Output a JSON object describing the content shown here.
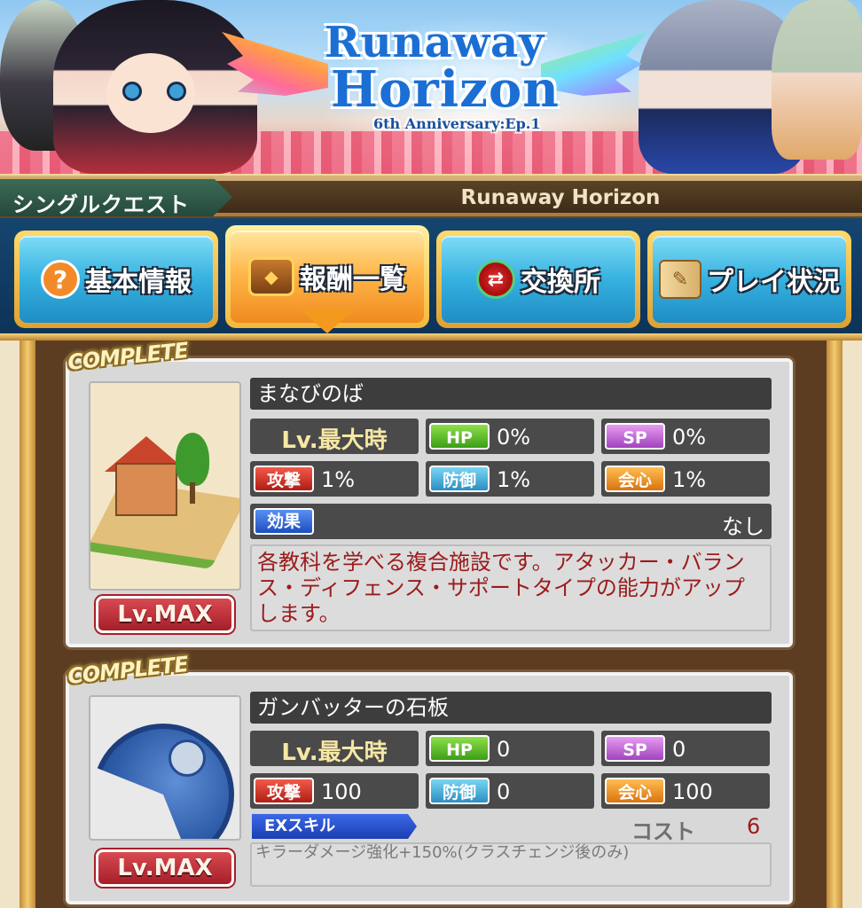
{
  "banner": {
    "logo_line1": "Runaway",
    "logo_line2": "Horizon",
    "logo_sub": "6th Anniversary:Ep.1"
  },
  "header": {
    "mode_label": "シングルクエスト",
    "quest_name": "Runaway Horizon"
  },
  "tabs": [
    {
      "label": "基本情報",
      "icon": "question-icon",
      "active": false
    },
    {
      "label": "報酬一覧",
      "icon": "treasure-chest-icon",
      "active": true
    },
    {
      "label": "交換所",
      "icon": "exchange-icon",
      "active": false
    },
    {
      "label": "プレイ状況",
      "icon": "scroll-icon",
      "active": false
    }
  ],
  "rewards": [
    {
      "complete_label": "COMPLETE",
      "level_label": "Lv.MAX",
      "name": "まなびのば",
      "lv_label": "Lv.最大時",
      "stats": {
        "hp_label": "HP",
        "hp": "0%",
        "sp_label": "SP",
        "sp": "0%",
        "atk_label": "攻撃",
        "atk": "1%",
        "def_label": "防御",
        "def": "1%",
        "crit_label": "会心",
        "crit": "1%"
      },
      "effect_label": "効果",
      "effect_value": "なし",
      "description": "各教科を学べる複合施設です。アタッカー・バランス・ディフェンス・サポートタイプの能力がアップします。"
    },
    {
      "complete_label": "COMPLETE",
      "level_label": "Lv.MAX",
      "name": "ガンバッターの石板",
      "lv_label": "Lv.最大時",
      "stats": {
        "hp_label": "HP",
        "hp": "0",
        "sp_label": "SP",
        "sp": "0",
        "atk_label": "攻撃",
        "atk": "100",
        "def_label": "防御",
        "def": "0",
        "crit_label": "会心",
        "crit": "100"
      },
      "ex_label": "EXスキル",
      "cost_label": "コスト",
      "cost_value": "6",
      "skill_description": "キラーダメージ強化+150%(クラスチェンジ後のみ)"
    }
  ],
  "colors": {
    "tab_active": "#f08a1e",
    "tab_inactive": "#36b1e0",
    "desc_text": "#9b1b1b",
    "lvmax_button": "#a51f28"
  }
}
